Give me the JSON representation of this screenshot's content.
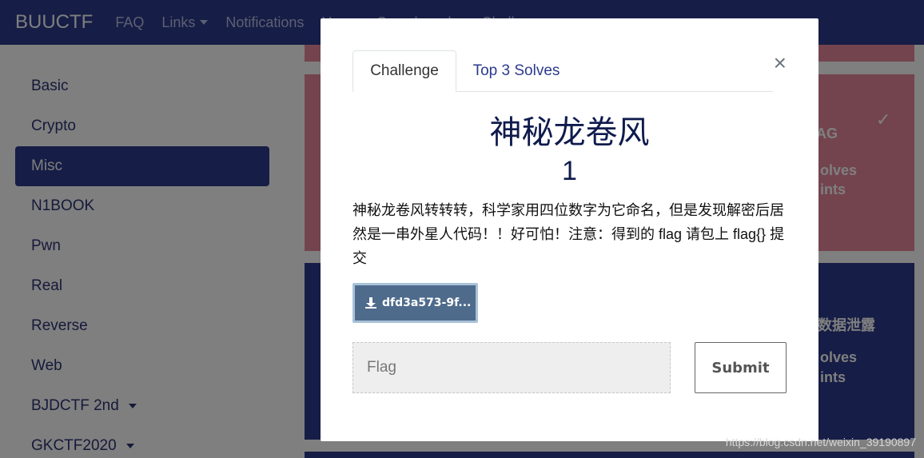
{
  "navbar": {
    "brand": "BUUCTF",
    "links": [
      "FAQ",
      "Links",
      "Notifications",
      "Users",
      "Scoreboard",
      "Challenges"
    ]
  },
  "sidebar": {
    "categories": [
      "Basic",
      "Crypto",
      "Misc",
      "N1BOOK",
      "Pwn",
      "Real",
      "Reverse",
      "Web",
      "BJDCTF 2nd",
      "GKCTF2020"
    ],
    "active": "Misc"
  },
  "background_cards": {
    "card1_fragment": "AG",
    "card1_line1": "olves",
    "card1_line2": "ints",
    "card2_fragment": "数据泄露",
    "card2_line1": "olves",
    "card2_line2": "ints"
  },
  "modal": {
    "tabs": [
      "Challenge",
      "Top 3 Solves"
    ],
    "close": "×",
    "title": "神秘龙卷风",
    "value": "1",
    "description": "神秘龙卷风转转转，科学家用四位数字为它命名，但是发现解密后居然是一串外星人代码！！好可怕！注意：得到的 flag 请包上 flag{} 提交",
    "file_label": "dfd3a573-9f...",
    "flag_placeholder": "Flag",
    "submit_label": "Submit"
  },
  "watermark": "https://blog.csdn.net/weixin_39190897",
  "colors": {
    "navbar": "#2c3a8c",
    "active_category": "#2c3a8c",
    "card_pink": "#e6889c",
    "card_blue": "#2c3a8c",
    "file_button": "#4e6b8c"
  },
  "icons": {
    "download": "download-icon",
    "check": "check-icon",
    "close": "close-icon"
  }
}
